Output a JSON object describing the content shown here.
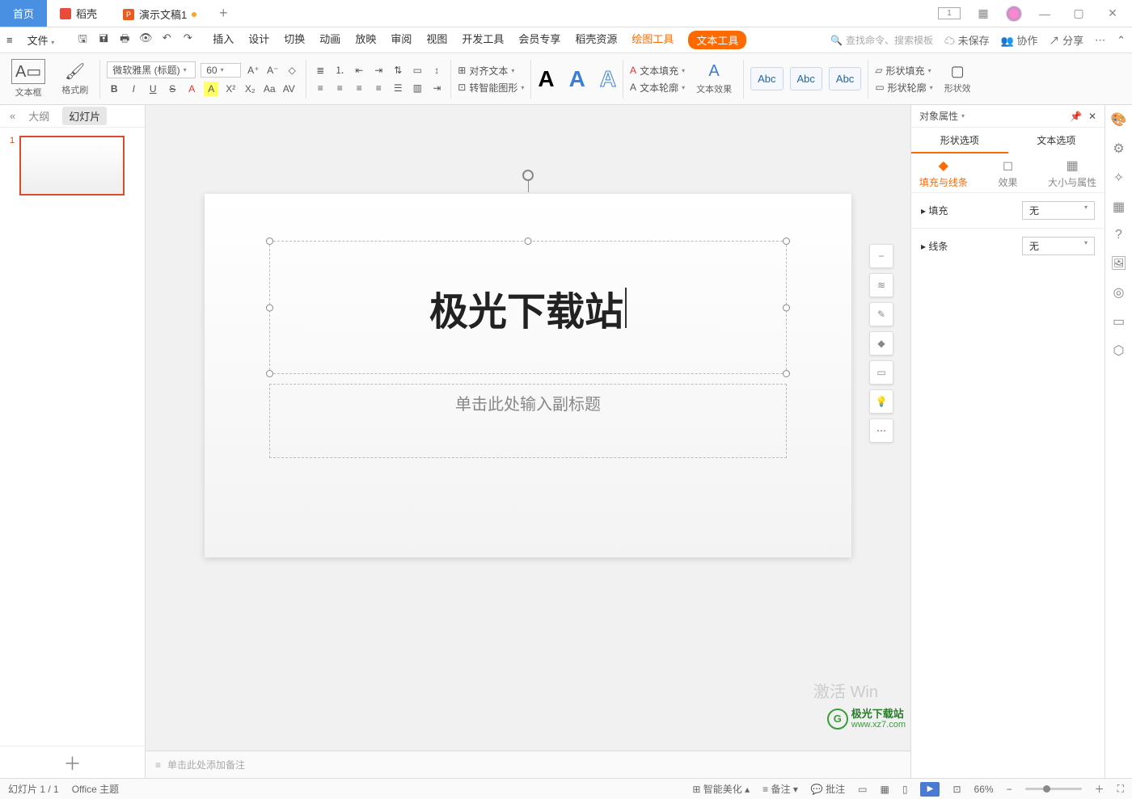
{
  "titlebar": {
    "tab_home": "首页",
    "tab_doke": "稻壳",
    "tab_doc": "演示文稿1",
    "add": "+"
  },
  "menubar": {
    "file": "文件",
    "tabs": [
      "插入",
      "设计",
      "切换",
      "动画",
      "放映",
      "审阅",
      "视图",
      "开发工具",
      "会员专享",
      "稻壳资源"
    ],
    "draw_tool": "绘图工具",
    "text_tool": "文本工具",
    "search_placeholder": "查找命令、搜索模板",
    "unsaved": "未保存",
    "coop": "协作",
    "share": "分享"
  },
  "ribbon": {
    "textbox": "文本框",
    "format_painter": "格式刷",
    "font_name": "微软雅黑 (标题)",
    "font_size": "60",
    "align_text": "对齐文本",
    "smart_convert": "转智能图形",
    "text_fill": "文本填充",
    "text_outline": "文本轮廓",
    "text_effects": "文本效果",
    "abc": "Abc",
    "shape_fill": "形状填充",
    "shape_outline": "形状轮廓",
    "shape_x": "形状效"
  },
  "leftpane": {
    "tab_outline": "大纲",
    "tab_slides": "幻灯片",
    "thumb_num": "1"
  },
  "slide": {
    "title": "极光下载站",
    "subtitle": "单击此处输入副标题"
  },
  "notes": {
    "placeholder": "单击此处添加备注"
  },
  "rightpane": {
    "header": "对象属性",
    "tab_shape": "形状选项",
    "tab_text": "文本选项",
    "sub_fill": "填充与线条",
    "sub_effect": "效果",
    "sub_size": "大小与属性",
    "fill_label": "填充",
    "line_label": "线条",
    "none": "无"
  },
  "statusbar": {
    "slide_pos": "幻灯片 1 / 1",
    "theme": "Office 主题",
    "smart_beautify": "智能美化",
    "notes_btn": "备注",
    "comments_btn": "批注",
    "zoom": "66%"
  },
  "watermark": {
    "activate": "激活 Win",
    "site": "极光下载站",
    "url": "www.xz7.com"
  }
}
